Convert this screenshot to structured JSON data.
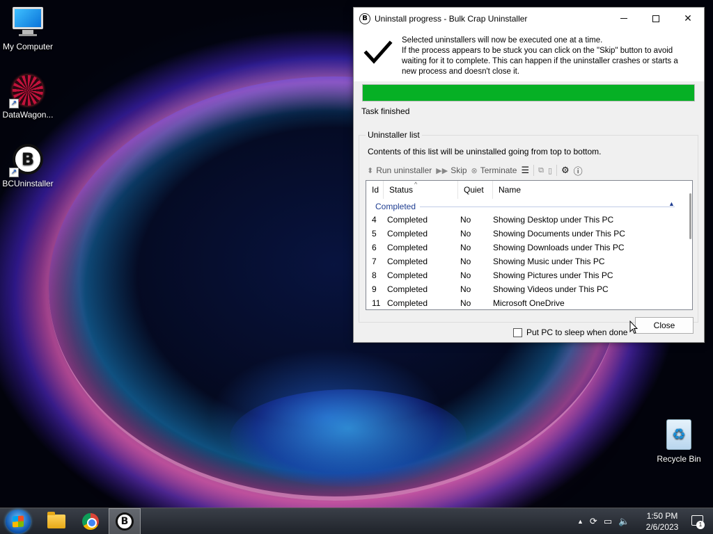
{
  "desktop": {
    "icons": [
      {
        "label": "My Computer"
      },
      {
        "label": "DataWagon..."
      },
      {
        "label": "BCUninstaller"
      },
      {
        "label": "Recycle Bin"
      }
    ]
  },
  "window": {
    "title": "Uninstall progress - Bulk Crap Uninstaller",
    "app_icon_letter": "B",
    "message_lines": [
      "Selected uninstallers will now be executed one at a time.",
      "If the process appears to be stuck you can click on the \"Skip\" button to avoid waiting for it to complete. This can happen if the uninstaller crashes or starts a new process and doesn't close it."
    ],
    "progress": {
      "percent": 100,
      "color": "#06b025"
    },
    "task_status": "Task finished",
    "group_title": "Uninstaller list",
    "group_description": "Contents of this list will be uninstalled going from top to bottom.",
    "toolbar": {
      "run": "Run uninstaller",
      "skip": "Skip",
      "terminate": "Terminate"
    },
    "list": {
      "columns": [
        "Id",
        "Status",
        "Quiet",
        "Name"
      ],
      "group_label": "Completed",
      "rows": [
        {
          "id": "4",
          "status": "Completed",
          "quiet": "No",
          "name": "Showing Desktop under This PC"
        },
        {
          "id": "5",
          "status": "Completed",
          "quiet": "No",
          "name": "Showing Documents under This PC"
        },
        {
          "id": "6",
          "status": "Completed",
          "quiet": "No",
          "name": "Showing Downloads under This PC"
        },
        {
          "id": "7",
          "status": "Completed",
          "quiet": "No",
          "name": "Showing Music under This PC"
        },
        {
          "id": "8",
          "status": "Completed",
          "quiet": "No",
          "name": "Showing Pictures under This PC"
        },
        {
          "id": "9",
          "status": "Completed",
          "quiet": "No",
          "name": "Showing Videos under This PC"
        },
        {
          "id": "11",
          "status": "Completed",
          "quiet": "No",
          "name": "Microsoft OneDrive"
        }
      ]
    },
    "sleep_checkbox_label": "Put PC to sleep when done",
    "sleep_checked": false,
    "close_label": "Close"
  },
  "taskbar": {
    "apps": [
      "start-button",
      "file-explorer",
      "chrome",
      "bc-uninstaller"
    ],
    "clock_time": "1:50 PM",
    "clock_date": "2/6/2023",
    "notification_count": "1"
  }
}
